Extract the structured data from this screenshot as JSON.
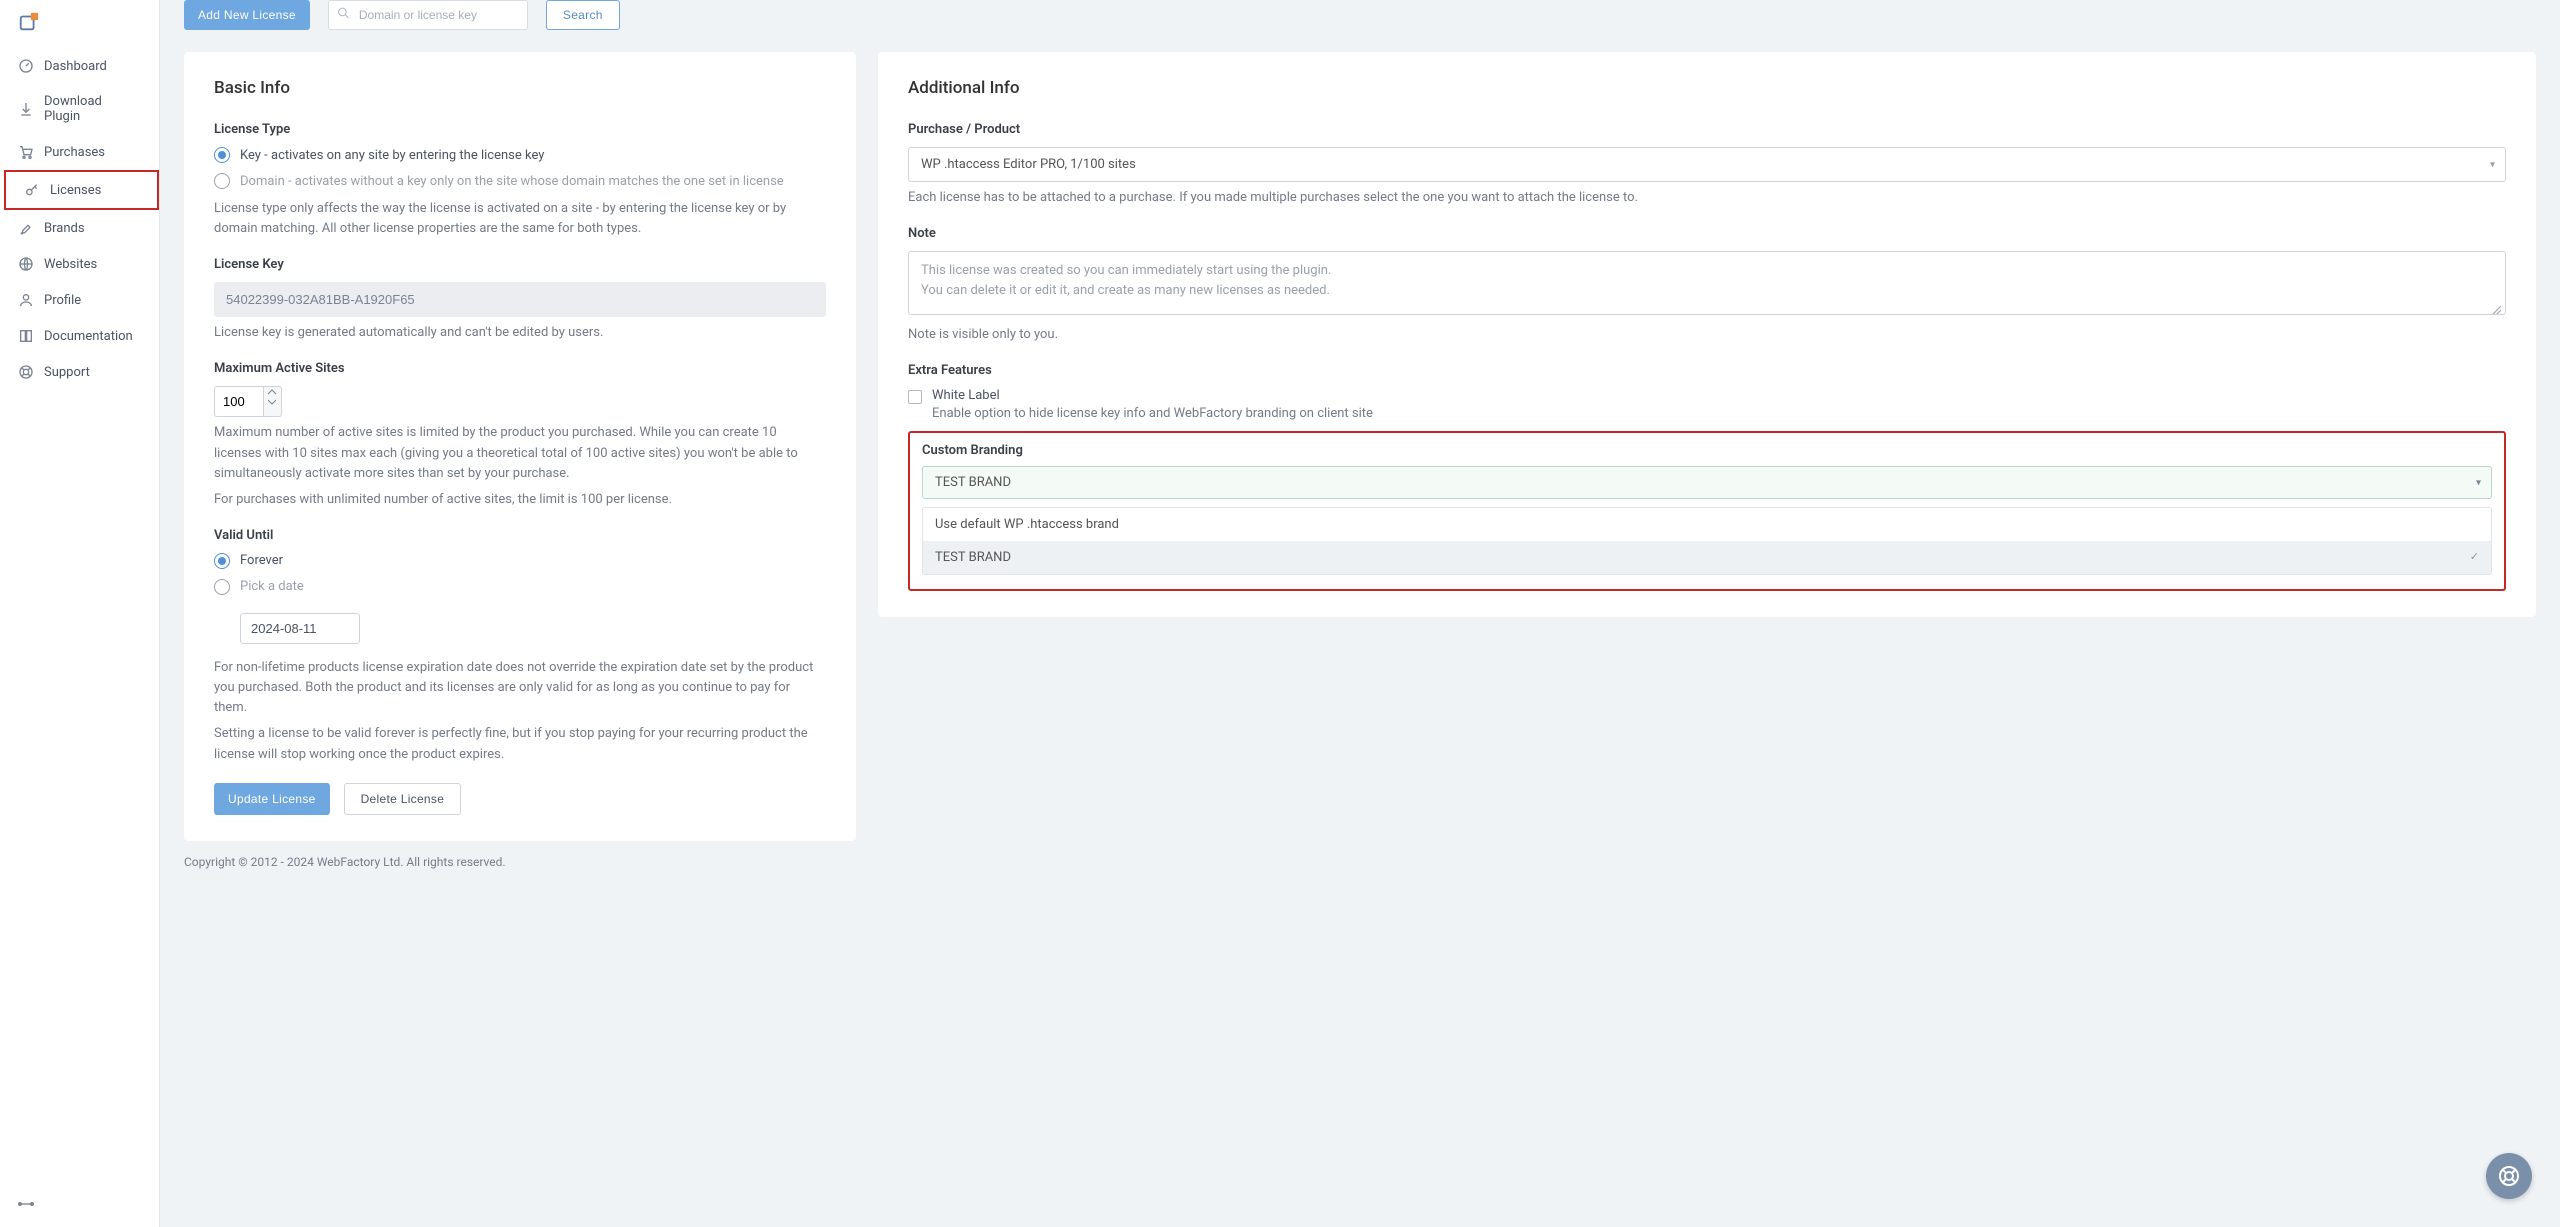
{
  "sidebar": {
    "items": [
      {
        "label": "Dashboard"
      },
      {
        "label": "Download Plugin"
      },
      {
        "label": "Purchases"
      },
      {
        "label": "Licenses"
      },
      {
        "label": "Brands"
      },
      {
        "label": "Websites"
      },
      {
        "label": "Profile"
      },
      {
        "label": "Documentation"
      },
      {
        "label": "Support"
      }
    ]
  },
  "actions": {
    "add_license": "Add New License",
    "search_placeholder": "Domain or license key",
    "search_btn": "Search"
  },
  "basic": {
    "title": "Basic Info",
    "type_label": "License Type",
    "radio_key": "Key - activates on any site by entering the license key",
    "radio_domain": "Domain - activates without a key only on the site whose domain matches the one set in license",
    "type_help": "License type only affects the way the license is activated on a site - by entering the license key or by domain matching. All other license properties are the same for both types.",
    "key_label": "License Key",
    "key_value": "54022399-032A81BB-A1920F65",
    "key_help": "License key is generated automatically and can't be edited by users.",
    "max_label": "Maximum Active Sites",
    "max_value": "100",
    "max_help_1": "Maximum number of active sites is limited by the product you purchased. While you can create 10 licenses with 10 sites max each (giving you a theoretical total of 100 active sites) you won't be able to simultaneously activate more sites than set by your purchase.",
    "max_help_2": "For purchases with unlimited number of active sites, the limit is 100 per license.",
    "valid_label": "Valid Until",
    "radio_forever": "Forever",
    "radio_pick": "Pick a date",
    "date_value": "2024-08-11",
    "valid_help_1": "For non-lifetime products license expiration date does not override the expiration date set by the product you purchased. Both the product and its licenses are only valid for as long as you continue to pay for them.",
    "valid_help_2": "Setting a license to be valid forever is perfectly fine, but if you stop paying for your recurring product the license will stop working once the product expires.",
    "update_btn": "Update License",
    "delete_btn": "Delete License"
  },
  "additional": {
    "title": "Additional Info",
    "purchase_label": "Purchase / Product",
    "purchase_value": "WP .htaccess Editor PRO, 1/100 sites",
    "purchase_help": "Each license has to be attached to a purchase. If you made multiple purchases select the one you want to attach the license to.",
    "note_label": "Note",
    "note_value": "This license was created so you can immediately start using the plugin.\nYou can delete it or edit it, and create as many new licenses as needed.",
    "note_help": "Note is visible only to you.",
    "extra_label": "Extra Features",
    "white_label": "White Label",
    "white_help": "Enable option to hide license key info and WebFactory branding on client site",
    "branding_label": "Custom Branding",
    "branding_value": "TEST BRAND",
    "dd_default": "Use default WP .htaccess brand",
    "dd_test": "TEST BRAND"
  },
  "footer": {
    "text": "Copyright © 2012 - 2024 WebFactory Ltd. All rights reserved."
  }
}
